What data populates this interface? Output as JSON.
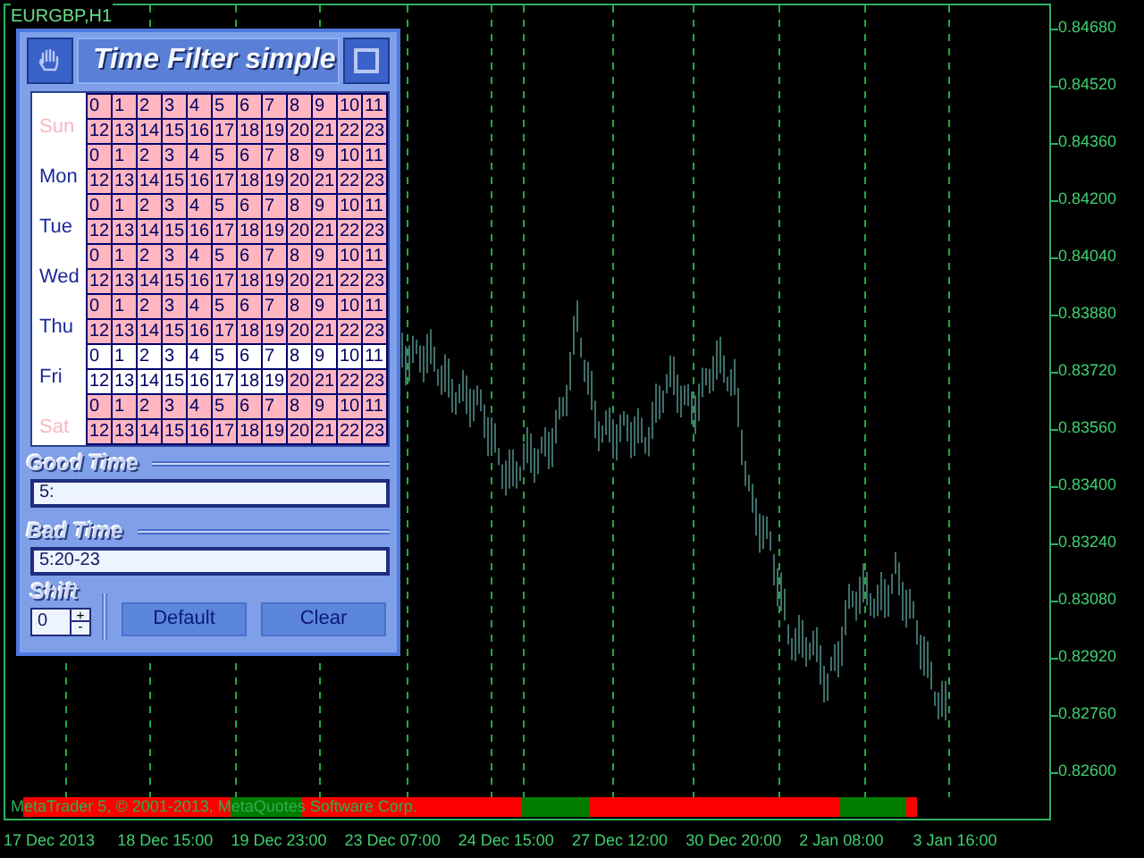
{
  "chart": {
    "symbol": "EURGBP,H1",
    "price_labels": [
      "0.84680",
      "0.84520",
      "0.84360",
      "0.84200",
      "0.84040",
      "0.83880",
      "0.83720",
      "0.83560",
      "0.83400",
      "0.83240",
      "0.83080",
      "0.82920",
      "0.82760",
      "0.82600"
    ],
    "time_labels": [
      "17 Dec 2013",
      "18 Dec 15:00",
      "19 Dec 23:00",
      "23 Dec 07:00",
      "24 Dec 15:00",
      "27 Dec 12:00",
      "30 Dec 20:00",
      "2 Jan 08:00",
      "3 Jan 16:00"
    ],
    "copyright": "MetaTrader 5, © 2001-2013, MetaQuotes Software Corp.",
    "filter_segments": [
      {
        "good": false
      },
      {
        "good": true
      },
      {
        "good": false
      },
      {
        "good": true
      },
      {
        "good": false
      },
      {
        "good": true
      },
      {
        "good": false
      }
    ]
  },
  "panel": {
    "title": "Time Filter simple",
    "days": [
      {
        "name": "Sun",
        "enabled": false,
        "hours": [
          {
            "label": "0",
            "good": false
          },
          {
            "label": "1",
            "good": false
          },
          {
            "label": "2",
            "good": false
          },
          {
            "label": "3",
            "good": false
          },
          {
            "label": "4",
            "good": false
          },
          {
            "label": "5",
            "good": false
          },
          {
            "label": "6",
            "good": false
          },
          {
            "label": "7",
            "good": false
          },
          {
            "label": "8",
            "good": false
          },
          {
            "label": "9",
            "good": false
          },
          {
            "label": "10",
            "good": false
          },
          {
            "label": "11",
            "good": false
          },
          {
            "label": "12",
            "good": false
          },
          {
            "label": "13",
            "good": false
          },
          {
            "label": "14",
            "good": false
          },
          {
            "label": "15",
            "good": false
          },
          {
            "label": "16",
            "good": false
          },
          {
            "label": "17",
            "good": false
          },
          {
            "label": "18",
            "good": false
          },
          {
            "label": "19",
            "good": false
          },
          {
            "label": "20",
            "good": false
          },
          {
            "label": "21",
            "good": false
          },
          {
            "label": "22",
            "good": false
          },
          {
            "label": "23",
            "good": false
          }
        ]
      },
      {
        "name": "Mon",
        "enabled": true,
        "hours": [
          {
            "label": "0",
            "good": false
          },
          {
            "label": "1",
            "good": false
          },
          {
            "label": "2",
            "good": false
          },
          {
            "label": "3",
            "good": false
          },
          {
            "label": "4",
            "good": false
          },
          {
            "label": "5",
            "good": false
          },
          {
            "label": "6",
            "good": false
          },
          {
            "label": "7",
            "good": false
          },
          {
            "label": "8",
            "good": false
          },
          {
            "label": "9",
            "good": false
          },
          {
            "label": "10",
            "good": false
          },
          {
            "label": "11",
            "good": false
          },
          {
            "label": "12",
            "good": false
          },
          {
            "label": "13",
            "good": false
          },
          {
            "label": "14",
            "good": false
          },
          {
            "label": "15",
            "good": false
          },
          {
            "label": "16",
            "good": false
          },
          {
            "label": "17",
            "good": false
          },
          {
            "label": "18",
            "good": false
          },
          {
            "label": "19",
            "good": false
          },
          {
            "label": "20",
            "good": false
          },
          {
            "label": "21",
            "good": false
          },
          {
            "label": "22",
            "good": false
          },
          {
            "label": "23",
            "good": false
          }
        ]
      },
      {
        "name": "Tue",
        "enabled": true,
        "hours": [
          {
            "label": "0",
            "good": false
          },
          {
            "label": "1",
            "good": false
          },
          {
            "label": "2",
            "good": false
          },
          {
            "label": "3",
            "good": false
          },
          {
            "label": "4",
            "good": false
          },
          {
            "label": "5",
            "good": false
          },
          {
            "label": "6",
            "good": false
          },
          {
            "label": "7",
            "good": false
          },
          {
            "label": "8",
            "good": false
          },
          {
            "label": "9",
            "good": false
          },
          {
            "label": "10",
            "good": false
          },
          {
            "label": "11",
            "good": false
          },
          {
            "label": "12",
            "good": false
          },
          {
            "label": "13",
            "good": false
          },
          {
            "label": "14",
            "good": false
          },
          {
            "label": "15",
            "good": false
          },
          {
            "label": "16",
            "good": false
          },
          {
            "label": "17",
            "good": false
          },
          {
            "label": "18",
            "good": false
          },
          {
            "label": "19",
            "good": false
          },
          {
            "label": "20",
            "good": false
          },
          {
            "label": "21",
            "good": false
          },
          {
            "label": "22",
            "good": false
          },
          {
            "label": "23",
            "good": false
          }
        ]
      },
      {
        "name": "Wed",
        "enabled": true,
        "hours": [
          {
            "label": "0",
            "good": false
          },
          {
            "label": "1",
            "good": false
          },
          {
            "label": "2",
            "good": false
          },
          {
            "label": "3",
            "good": false
          },
          {
            "label": "4",
            "good": false
          },
          {
            "label": "5",
            "good": false
          },
          {
            "label": "6",
            "good": false
          },
          {
            "label": "7",
            "good": false
          },
          {
            "label": "8",
            "good": false
          },
          {
            "label": "9",
            "good": false
          },
          {
            "label": "10",
            "good": false
          },
          {
            "label": "11",
            "good": false
          },
          {
            "label": "12",
            "good": false
          },
          {
            "label": "13",
            "good": false
          },
          {
            "label": "14",
            "good": false
          },
          {
            "label": "15",
            "good": false
          },
          {
            "label": "16",
            "good": false
          },
          {
            "label": "17",
            "good": false
          },
          {
            "label": "18",
            "good": false
          },
          {
            "label": "19",
            "good": false
          },
          {
            "label": "20",
            "good": false
          },
          {
            "label": "21",
            "good": false
          },
          {
            "label": "22",
            "good": false
          },
          {
            "label": "23",
            "good": false
          }
        ]
      },
      {
        "name": "Thu",
        "enabled": true,
        "hours": [
          {
            "label": "0",
            "good": false
          },
          {
            "label": "1",
            "good": false
          },
          {
            "label": "2",
            "good": false
          },
          {
            "label": "3",
            "good": false
          },
          {
            "label": "4",
            "good": false
          },
          {
            "label": "5",
            "good": false
          },
          {
            "label": "6",
            "good": false
          },
          {
            "label": "7",
            "good": false
          },
          {
            "label": "8",
            "good": false
          },
          {
            "label": "9",
            "good": false
          },
          {
            "label": "10",
            "good": false
          },
          {
            "label": "11",
            "good": false
          },
          {
            "label": "12",
            "good": false
          },
          {
            "label": "13",
            "good": false
          },
          {
            "label": "14",
            "good": false
          },
          {
            "label": "15",
            "good": false
          },
          {
            "label": "16",
            "good": false
          },
          {
            "label": "17",
            "good": false
          },
          {
            "label": "18",
            "good": false
          },
          {
            "label": "19",
            "good": false
          },
          {
            "label": "20",
            "good": false
          },
          {
            "label": "21",
            "good": false
          },
          {
            "label": "22",
            "good": false
          },
          {
            "label": "23",
            "good": false
          }
        ]
      },
      {
        "name": "Fri",
        "enabled": true,
        "hours": [
          {
            "label": "0",
            "good": true
          },
          {
            "label": "1",
            "good": true
          },
          {
            "label": "2",
            "good": true
          },
          {
            "label": "3",
            "good": true
          },
          {
            "label": "4",
            "good": true
          },
          {
            "label": "5",
            "good": true
          },
          {
            "label": "6",
            "good": true
          },
          {
            "label": "7",
            "good": true
          },
          {
            "label": "8",
            "good": true
          },
          {
            "label": "9",
            "good": true
          },
          {
            "label": "10",
            "good": true
          },
          {
            "label": "11",
            "good": true
          },
          {
            "label": "12",
            "good": true
          },
          {
            "label": "13",
            "good": true
          },
          {
            "label": "14",
            "good": true
          },
          {
            "label": "15",
            "good": true
          },
          {
            "label": "16",
            "good": true
          },
          {
            "label": "17",
            "good": true
          },
          {
            "label": "18",
            "good": true
          },
          {
            "label": "19",
            "good": true
          },
          {
            "label": "20",
            "good": false
          },
          {
            "label": "21",
            "good": false
          },
          {
            "label": "22",
            "good": false
          },
          {
            "label": "23",
            "good": false
          }
        ]
      },
      {
        "name": "Sat",
        "enabled": false,
        "hours": [
          {
            "label": "0",
            "good": false
          },
          {
            "label": "1",
            "good": false
          },
          {
            "label": "2",
            "good": false
          },
          {
            "label": "3",
            "good": false
          },
          {
            "label": "4",
            "good": false
          },
          {
            "label": "5",
            "good": false
          },
          {
            "label": "6",
            "good": false
          },
          {
            "label": "7",
            "good": false
          },
          {
            "label": "8",
            "good": false
          },
          {
            "label": "9",
            "good": false
          },
          {
            "label": "10",
            "good": false
          },
          {
            "label": "11",
            "good": false
          },
          {
            "label": "12",
            "good": false
          },
          {
            "label": "13",
            "good": false
          },
          {
            "label": "14",
            "good": false
          },
          {
            "label": "15",
            "good": false
          },
          {
            "label": "16",
            "good": false
          },
          {
            "label": "17",
            "good": false
          },
          {
            "label": "18",
            "good": false
          },
          {
            "label": "19",
            "good": false
          },
          {
            "label": "20",
            "good": false
          },
          {
            "label": "21",
            "good": false
          },
          {
            "label": "22",
            "good": false
          },
          {
            "label": "23",
            "good": false
          }
        ]
      }
    ],
    "good_time": {
      "label": "Good Time",
      "value": "5:"
    },
    "bad_time": {
      "label": "Bad Time",
      "value": "5:20-23"
    },
    "shift": {
      "label": "Shift",
      "value": "0",
      "up": "+",
      "down": "-"
    },
    "buttons": [
      "Default",
      "Clear"
    ]
  }
}
